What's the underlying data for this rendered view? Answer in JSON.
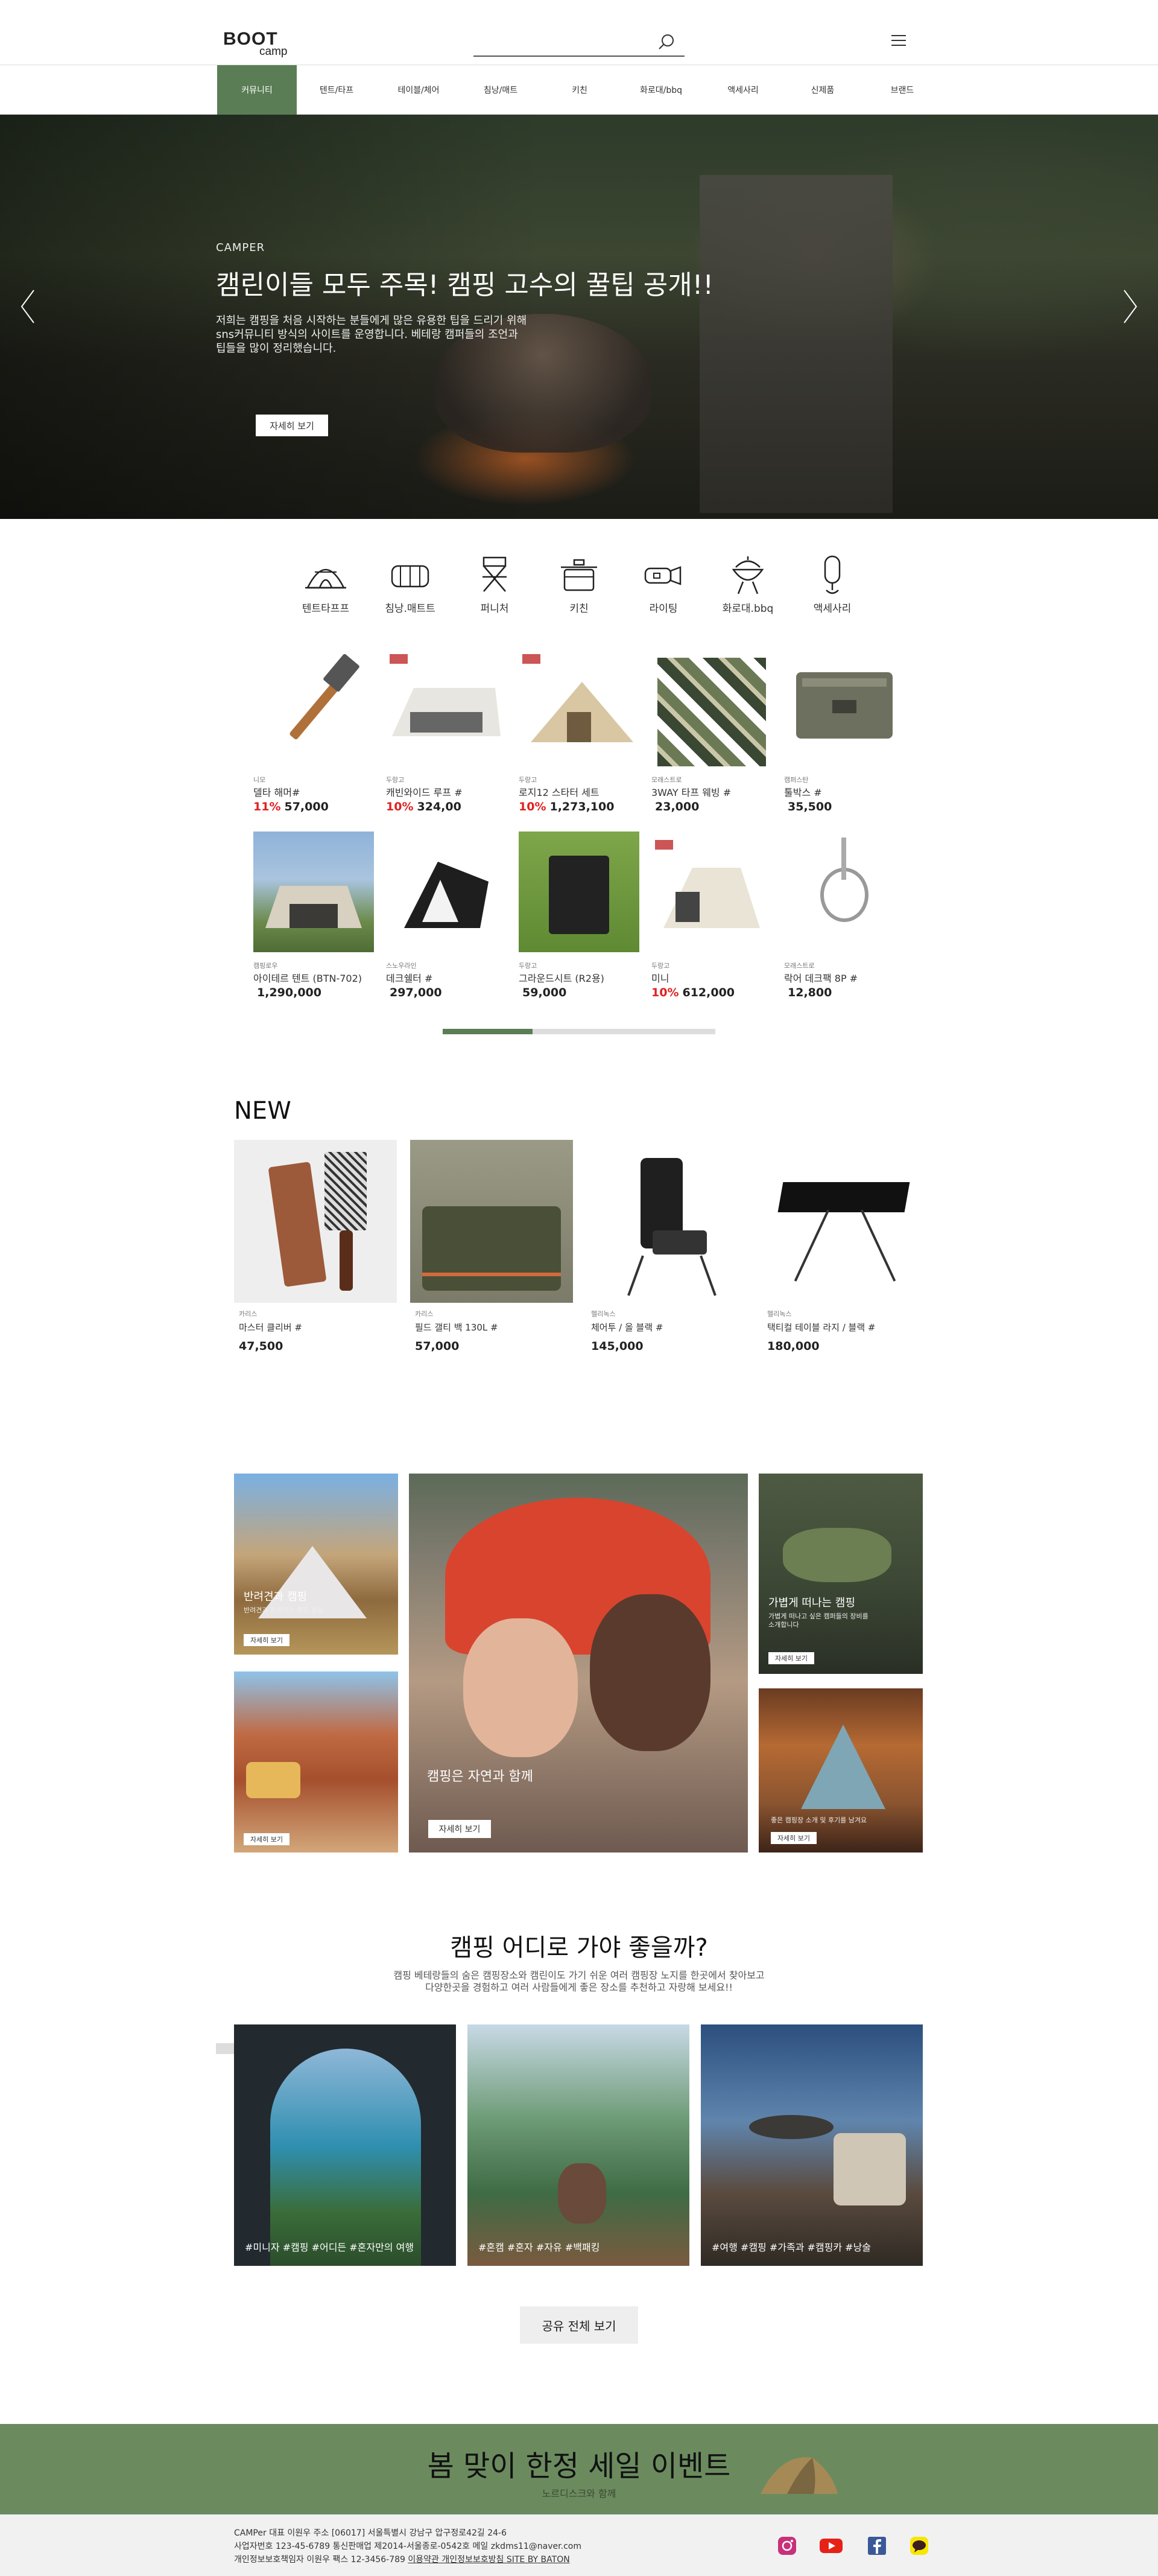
{
  "header": {
    "logo_line1": "BOOT",
    "logo_line2": "camp",
    "search_placeholder": ""
  },
  "nav": {
    "items": [
      "커뮤니티",
      "텐트/타프",
      "테이블/체어",
      "침낭/매트",
      "키친",
      "화로대/bbq",
      "액세사리",
      "신제품",
      "브랜드"
    ],
    "active_index": 0
  },
  "hero": {
    "tag": "CAMPER",
    "title": "캠린이들 모두 주목! 캠핑 고수의 꿀팁 공개!!",
    "desc_line1": "저희는 캠핑을 처음 시작하는 분들에게 많은 유용한 팁을 드리기 위해",
    "desc_line2": "sns커뮤니티 방식의 사이트를 운영합니다. 베테랑 캠퍼들의 조언과",
    "desc_line3": "팁들을 많이 정리했습니다.",
    "button": "자세히 보기"
  },
  "categories": [
    "텐트타프프",
    "침낭.매트트",
    "퍼니처",
    "키친",
    "라이팅",
    "화로대.bbq",
    "액세사리"
  ],
  "products": [
    {
      "brand": "니모",
      "name": "델타 해머#",
      "discount": "11%",
      "price": "57,000"
    },
    {
      "brand": "두랑고",
      "name": "캐빈와이드 루프 #",
      "discount": "10%",
      "price": "324,00"
    },
    {
      "brand": "두랑고",
      "name": "로지12 스타터 세트",
      "discount": "10%",
      "price": "1,273,100"
    },
    {
      "brand": "모래스트로",
      "name": "3WAY 타프 웨빙 #",
      "discount": "",
      "price": "23,000"
    },
    {
      "brand": "캠퍼스탄",
      "name": "툴박스 #",
      "discount": "",
      "price": "35,500"
    },
    {
      "brand": "캠핑로우",
      "name": "아이테르 텐트 (BTN-702)",
      "discount": "",
      "price": "1,290,000"
    },
    {
      "brand": "스노우라인",
      "name": "데크쉘터 #",
      "discount": "",
      "price": "297,000"
    },
    {
      "brand": "두랑고",
      "name": "그라운드시트 (R2용)",
      "discount": "",
      "price": "59,000"
    },
    {
      "brand": "두랑고",
      "name": "미니",
      "discount": "10%",
      "price": "612,000"
    },
    {
      "brand": "모래스트로",
      "name": "락어 데크팩 8P #",
      "discount": "",
      "price": "12,800"
    }
  ],
  "products_scroll_progress": 0.33,
  "new_section": {
    "title": "NEW",
    "items": [
      {
        "brand": "카리스",
        "name": "마스터 클리버 #",
        "price": "47,500"
      },
      {
        "brand": "카리스",
        "name": "필드 갤티 백 130L #",
        "price": "57,000"
      },
      {
        "brand": "헬리녹스",
        "name": "체어투 / 올 블랙 #",
        "price": "145,000"
      },
      {
        "brand": "헬리녹스",
        "name": "택티컬 테이블 라지 / 블랙 #",
        "price": "180,000"
      }
    ]
  },
  "features": {
    "tile1": {
      "title": "반려견과 캠핑",
      "desc": "반려견과 함께하는 캠핑 꿀팁",
      "button": "자세히 보기"
    },
    "tile2": {
      "title": "",
      "desc": "",
      "button": "자세히 보기"
    },
    "tile3": {
      "title": "캠핑은 자연과 함께",
      "desc": "",
      "button": "자세히 보기"
    },
    "tile4": {
      "title": "가볍게 떠나는 캠핑",
      "desc": "가볍게 떠나고 싶은 캠퍼들의 장비를 소개합니다",
      "button": "자세히 보기"
    },
    "tile5": {
      "title": "",
      "desc": "좋은 캠핑장 소개 및 후기를 남겨요",
      "button": "자세히 보기"
    }
  },
  "where": {
    "title": "캠핑 어디로 가야 좋을까?",
    "desc_line1": "캠핑 베테랑들의 숨은 캠핑장소와 캠린이도 가기 쉬운 여러 캠핑장 노지를 한곳에서 찾아보고",
    "desc_line2": "다양한곳을 경험하고 여러 사람들에게 좋은 장소를 추천하고 자랑해 보세요!!",
    "cards": [
      "#미니자 #캠핑 #어디든 #혼자만의 여행",
      "#혼캠 #혼자 #자유 #백패킹",
      "#여행 #캠핑 #가족과 #캠핑카 #낭술"
    ],
    "share_button": "공유 전체 보기"
  },
  "banner": {
    "title": "봄 맞이 한정 세일 이벤트",
    "subtitle": "노르디스크와 함께"
  },
  "footer": {
    "line1": "CAMPer 대표 이원우 주소 [06017] 서울특별시 강남구 압구정로42길 24-6",
    "line2": "사업자번호 123-45-6789 통신판매업 제2014-서울종로-0542호 메일 zkdms11@naver.com",
    "line3_prefix": "개인정보보호책임자 이원우 팩스 12-3456-789 ",
    "line3_link": "이용약관 개인정보보호방침 SITE BY BATON"
  },
  "social_icons": [
    "instagram-icon",
    "youtube-icon",
    "facebook-icon",
    "kakaotalk-icon"
  ],
  "colors": {
    "accent": "#5a7d55",
    "discount": "#e02020",
    "banner": "#6b8b5f"
  }
}
